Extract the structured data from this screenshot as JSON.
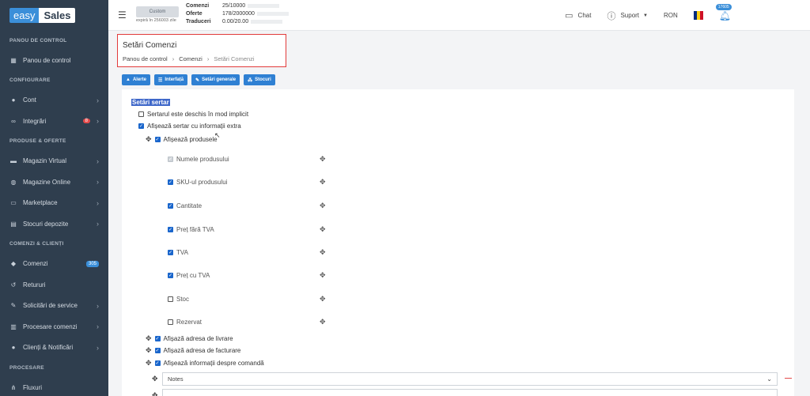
{
  "brand": {
    "easy": "easy",
    "sales": "Sales"
  },
  "sidebar": {
    "sections": [
      {
        "title": "PANOU DE CONTROL",
        "items": [
          {
            "label": "Panou de control",
            "icon": "dashboard-icon"
          }
        ]
      },
      {
        "title": "CONFIGURARE",
        "items": [
          {
            "label": "Cont",
            "icon": "user-icon"
          },
          {
            "label": "Integrări",
            "icon": "link-icon",
            "badge": "8"
          }
        ]
      },
      {
        "title": "PRODUSE & OFERTE",
        "items": [
          {
            "label": "Magazin Virtual",
            "icon": "store-icon"
          },
          {
            "label": "Magazine Online",
            "icon": "globe-icon"
          },
          {
            "label": "Marketplace",
            "icon": "cart-icon"
          },
          {
            "label": "Stocuri depozite",
            "icon": "warehouse-icon"
          }
        ]
      },
      {
        "title": "COMENZI & CLIENȚI",
        "items": [
          {
            "label": "Comenzi",
            "icon": "tag-icon",
            "badge": "305"
          },
          {
            "label": "Retururi",
            "icon": "return-icon"
          },
          {
            "label": "Solicitări de service",
            "icon": "wrench-icon"
          },
          {
            "label": "Procesare comenzi",
            "icon": "process-icon"
          },
          {
            "label": "Clienți & Notificări",
            "icon": "users-icon"
          }
        ]
      },
      {
        "title": "PROCESARE",
        "items": [
          {
            "label": "Fluxuri",
            "icon": "flow-icon"
          }
        ]
      }
    ]
  },
  "topbar": {
    "plan": "Custom",
    "expires": "expiră în 256003 zile",
    "quotas": [
      {
        "label": "Comenzi",
        "value": "25/10000"
      },
      {
        "label": "Oferte",
        "value": "178/2000000"
      },
      {
        "label": "Traduceri",
        "value": "0.00/20.00"
      }
    ],
    "chat": "Chat",
    "support": "Suport",
    "currency": "RON",
    "notifications": "17605",
    "flag_colors": [
      "#002b7f",
      "#fcd116",
      "#ce1126"
    ]
  },
  "header": {
    "title": "Setări Comenzi",
    "breadcrumb": [
      "Panou de control",
      "Comenzi",
      "Setări Comenzi"
    ]
  },
  "tabs": [
    {
      "label": "Alerte",
      "icon": "bell-icon"
    },
    {
      "label": "Interfață",
      "icon": "list-icon"
    },
    {
      "label": "Setări generale",
      "icon": "wrench-icon"
    },
    {
      "label": "Stocuri",
      "icon": "boxes-icon"
    }
  ],
  "settings": {
    "section_title": "Setări sertar",
    "drawer_open": "Sertarul este deschis în mod implicit",
    "show_extra": "Afișează sertar cu informații extra",
    "show_products": "Afișează produsele",
    "product_fields": [
      {
        "label": "Numele produsului",
        "state": "disabled"
      },
      {
        "label": "SKU-ul produsului",
        "state": "checked"
      },
      {
        "label": "Cantitate",
        "state": "checked"
      },
      {
        "label": "Preț fără TVA",
        "state": "checked"
      },
      {
        "label": "TVA",
        "state": "checked"
      },
      {
        "label": "Preț cu TVA",
        "state": "checked"
      },
      {
        "label": "Stoc",
        "state": "unchecked"
      },
      {
        "label": "Rezervat",
        "state": "unchecked"
      }
    ],
    "show_delivery": "Afișază adresa de livrare",
    "show_billing": "Afișază adresa de facturare",
    "show_order_info": "Afișează informații despre comandă",
    "order_info_select": "Notes"
  }
}
